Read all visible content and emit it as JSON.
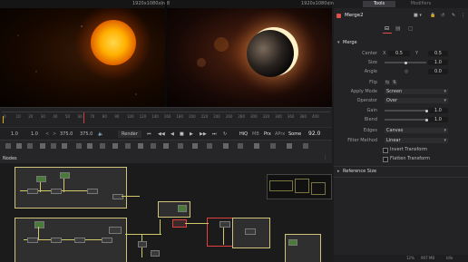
{
  "viewer_left": {
    "resolution": "1920x1080xint8"
  },
  "viewer_right": {
    "resolution": "1920x1080xint8"
  },
  "ruler": {
    "ticks": [
      "0",
      "10",
      "20",
      "30",
      "40",
      "50",
      "60",
      "70",
      "80",
      "90",
      "100",
      "120",
      "140",
      "160",
      "180",
      "200",
      "220",
      "240",
      "260",
      "280",
      "300",
      "320",
      "340",
      "360",
      "380",
      "400"
    ]
  },
  "transport": {
    "start": "1.0",
    "current_left": "1.0",
    "end": "375.0",
    "end2": "375.0",
    "render_label": "Render",
    "hiq_label": "HiQ",
    "mb_label": "MB",
    "prx_label": "Prx",
    "aprx_label": "APrx",
    "some_label": "Some",
    "frame": "92.0"
  },
  "nodes_panel": {
    "title": "Nodes"
  },
  "inspector": {
    "tab_tools": "Tools",
    "tab_modifiers": "Modifiers",
    "node_name": "Merge2",
    "section_merge": "Merge",
    "center_label": "Center",
    "center_x_label": "X",
    "center_x": "0.5",
    "center_y_label": "Y",
    "center_y": "0.5",
    "size_label": "Size",
    "size_value": "1.0",
    "angle_label": "Angle",
    "angle_value": "0.0",
    "flip_label": "Flip",
    "apply_mode_label": "Apply Mode",
    "apply_mode_value": "Screen",
    "operator_label": "Operator",
    "operator_value": "Over",
    "gain_label": "Gain",
    "gain_value": "1.0",
    "blend_label": "Blend",
    "blend_value": "1.0",
    "edges_label": "Edges",
    "edges_value": "Canvas",
    "filter_method_label": "Filter Method",
    "filter_method_value": "Linear",
    "invert_transform_label": "Invert Transform",
    "flatten_transform_label": "Flatten Transform",
    "section_reference": "Reference Size",
    "size_level": 0.5,
    "gain_level": 1.0,
    "blend_level": 1.0
  },
  "status": {
    "zoom": "12%",
    "memory": "907 MB",
    "fps": "Idle"
  },
  "colors": {
    "accent": "#e0504a",
    "wire": "#cfc96a",
    "node_border": "#cfc27a"
  }
}
